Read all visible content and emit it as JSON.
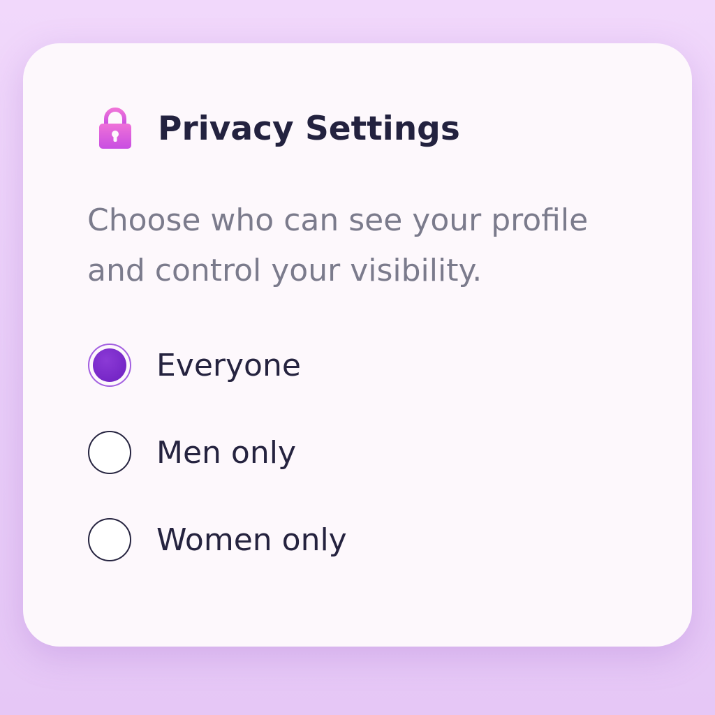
{
  "header": {
    "title": "Privacy Settings",
    "icon": "lock-icon"
  },
  "description": {
    "line1": "Choose who can see your profile",
    "line2": "and control your visibility."
  },
  "visibility_options": {
    "selected": "Everyone",
    "items": [
      {
        "label": "Everyone",
        "selected": true
      },
      {
        "label": "Men only",
        "selected": false
      },
      {
        "label": "Women only",
        "selected": false
      }
    ]
  },
  "colors": {
    "accent": "#7a2bd0",
    "text_primary": "#23223f",
    "text_secondary": "#7b7b8c",
    "lock_gradient_start": "#ea6fd9",
    "lock_gradient_end": "#c44fe0"
  }
}
